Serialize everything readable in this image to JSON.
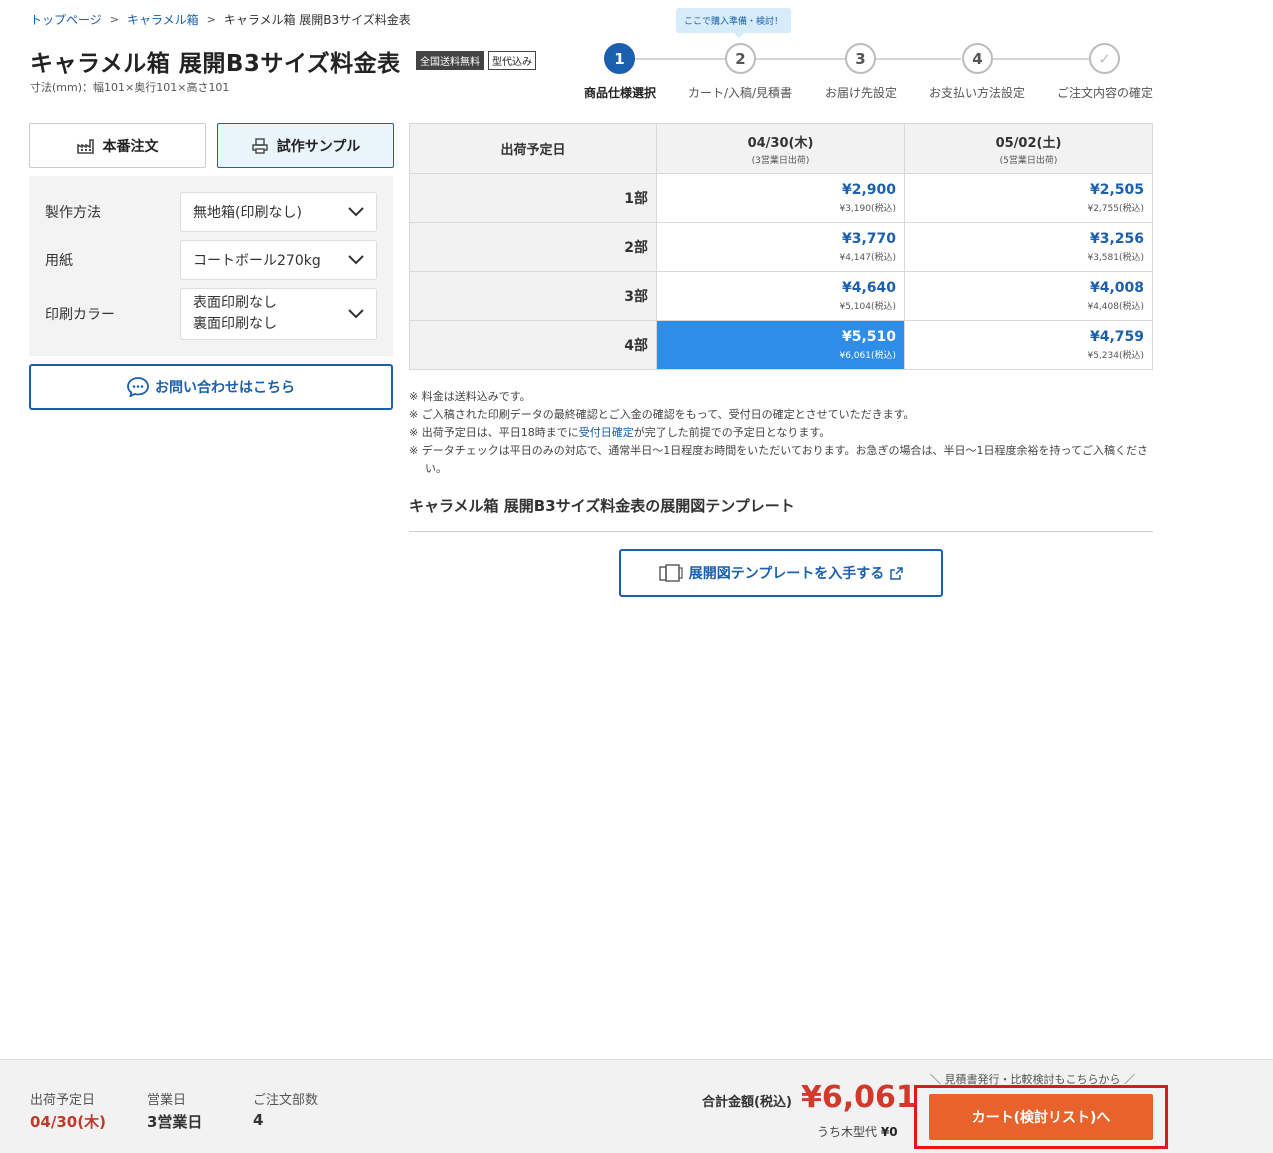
{
  "breadcrumb": {
    "home": "トップページ",
    "category": "キャラメル箱",
    "current": "キャラメル箱 展開B3サイズ料金表"
  },
  "title": "キャラメル箱 展開B3サイズ料金表",
  "badges": {
    "shipping": "全国送料無料",
    "mold": "型代込み"
  },
  "dimensions": "寸法(mm)：幅101×奥行101×高さ101",
  "steps": {
    "tooltip": "ここで購入準備・検討！",
    "items": [
      {
        "num": "1",
        "label": "商品仕様選択"
      },
      {
        "num": "2",
        "label": "カート/入稿/見積書"
      },
      {
        "num": "3",
        "label": "お届け先設定"
      },
      {
        "num": "4",
        "label": "お支払い方法設定"
      },
      {
        "num": "✓",
        "label": "ご注文内容の確定"
      }
    ]
  },
  "order_tabs": {
    "production": "本番注文",
    "sample": "試作サンプル"
  },
  "form": {
    "method_label": "製作方法",
    "method_value": "無地箱(印刷なし)",
    "paper_label": "用紙",
    "paper_value": "コートボール270kg",
    "color_label": "印刷カラー",
    "color_value_1": "表面印刷なし",
    "color_value_2": "裏面印刷なし"
  },
  "contact_button": "お問い合わせはこちら",
  "price_table": {
    "header": "出荷予定日",
    "cols": [
      {
        "date": "04/30(木)",
        "sub": "(3営業日出荷)"
      },
      {
        "date": "05/02(土)",
        "sub": "(5営業日出荷)"
      }
    ],
    "rows": [
      {
        "qty": "1部",
        "prices": [
          {
            "main": "¥2,900",
            "tax": "¥3,190(税込)"
          },
          {
            "main": "¥2,505",
            "tax": "¥2,755(税込)"
          }
        ]
      },
      {
        "qty": "2部",
        "prices": [
          {
            "main": "¥3,770",
            "tax": "¥4,147(税込)"
          },
          {
            "main": "¥3,256",
            "tax": "¥3,581(税込)"
          }
        ]
      },
      {
        "qty": "3部",
        "prices": [
          {
            "main": "¥4,640",
            "tax": "¥5,104(税込)"
          },
          {
            "main": "¥4,008",
            "tax": "¥4,408(税込)"
          }
        ]
      },
      {
        "qty": "4部",
        "prices": [
          {
            "main": "¥5,510",
            "tax": "¥6,061(税込)"
          },
          {
            "main": "¥4,759",
            "tax": "¥5,234(税込)"
          }
        ]
      }
    ]
  },
  "notes": {
    "n1": "※ 料金は送料込みです。",
    "n2": "※ ご入稿された印刷データの最終確認とご入金の確認をもって、受付日の確定とさせていただきます。",
    "n3_pre": "※ 出荷予定日は、平日18時までに",
    "n3_link": "受付日確定",
    "n3_post": "が完了した前提での予定日となります。",
    "n4": "※ データチェックは平日のみの対応で、通常半日〜1日程度お時間をいただいております。お急ぎの場合は、半日〜1日程度余裕を持ってご入稿ください。"
  },
  "template": {
    "heading": "キャラメル箱 展開B3サイズ料金表の展開図テンプレート",
    "button": "展開図テンプレートを入手する"
  },
  "footer": {
    "ship_label": "出荷予定日",
    "ship_value": "04/30(木)",
    "days_label": "営業日",
    "days_value": "3営業日",
    "qty_label": "ご注文部数",
    "qty_value": "4",
    "total_label": "合計金額(税込)",
    "total_value": "¥6,061",
    "mold_label": "うち木型代",
    "mold_value": "¥0",
    "estimate_note": "＼ 見積書発行・比較検討もこちらから ／",
    "cart_button": "カート(検討リスト)へ"
  },
  "colors": {
    "primary": "#1b5fae",
    "selected_cell": "#2e8de6",
    "cta": "#e8632b",
    "total": "#d0392b",
    "highlight": "#e8141b"
  }
}
